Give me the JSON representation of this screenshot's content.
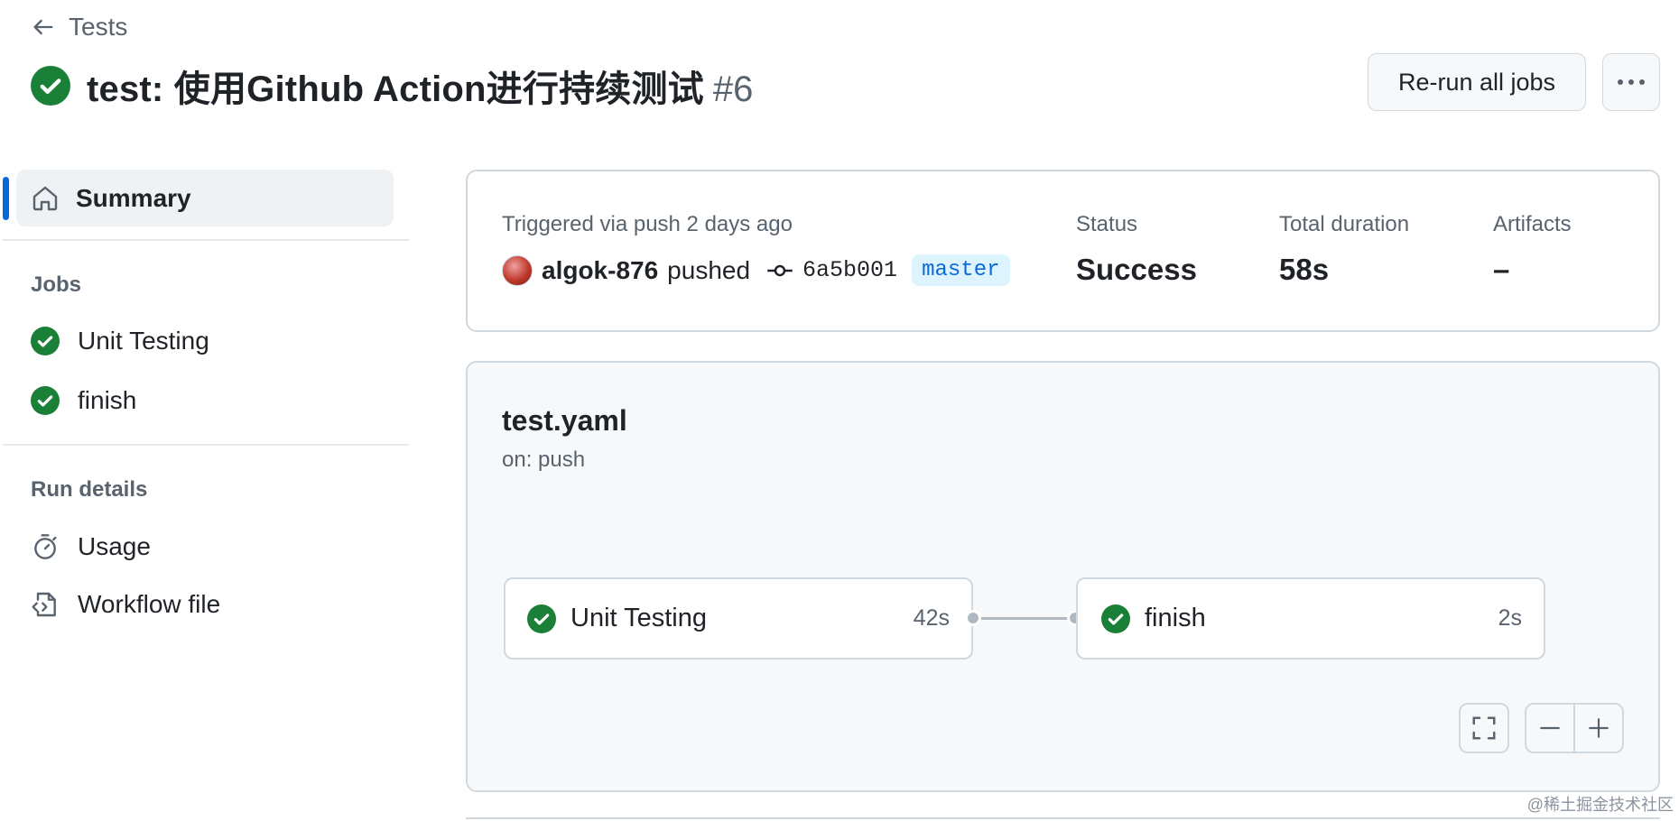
{
  "header": {
    "back_label": "Tests",
    "title": "test: 使用Github Action进行持续测试",
    "run_number": "#6",
    "rerun_label": "Re-run all jobs"
  },
  "sidebar": {
    "summary_label": "Summary",
    "jobs_heading": "Jobs",
    "jobs": [
      {
        "label": "Unit Testing"
      },
      {
        "label": "finish"
      }
    ],
    "run_details_heading": "Run details",
    "run_details": [
      {
        "label": "Usage",
        "icon": "stopwatch-icon"
      },
      {
        "label": "Workflow file",
        "icon": "file-code-icon"
      }
    ]
  },
  "summary": {
    "trigger_text": "Triggered via push 2 days ago",
    "actor": "algok-876",
    "action": "pushed",
    "commit_sha": "6a5b001",
    "branch": "master",
    "status_label": "Status",
    "status_value": "Success",
    "duration_label": "Total duration",
    "duration_value": "58s",
    "artifacts_label": "Artifacts",
    "artifacts_value": "–"
  },
  "workflow": {
    "name": "test.yaml",
    "trigger": "on: push",
    "jobs": [
      {
        "name": "Unit Testing",
        "duration": "42s",
        "status": "success"
      },
      {
        "name": "finish",
        "duration": "2s",
        "status": "success"
      }
    ]
  },
  "watermark": "@稀土掘金技术社区",
  "colors": {
    "success": "#1a7f37",
    "accent": "#0969da",
    "muted": "#59636e",
    "border": "#d1d9e0"
  }
}
